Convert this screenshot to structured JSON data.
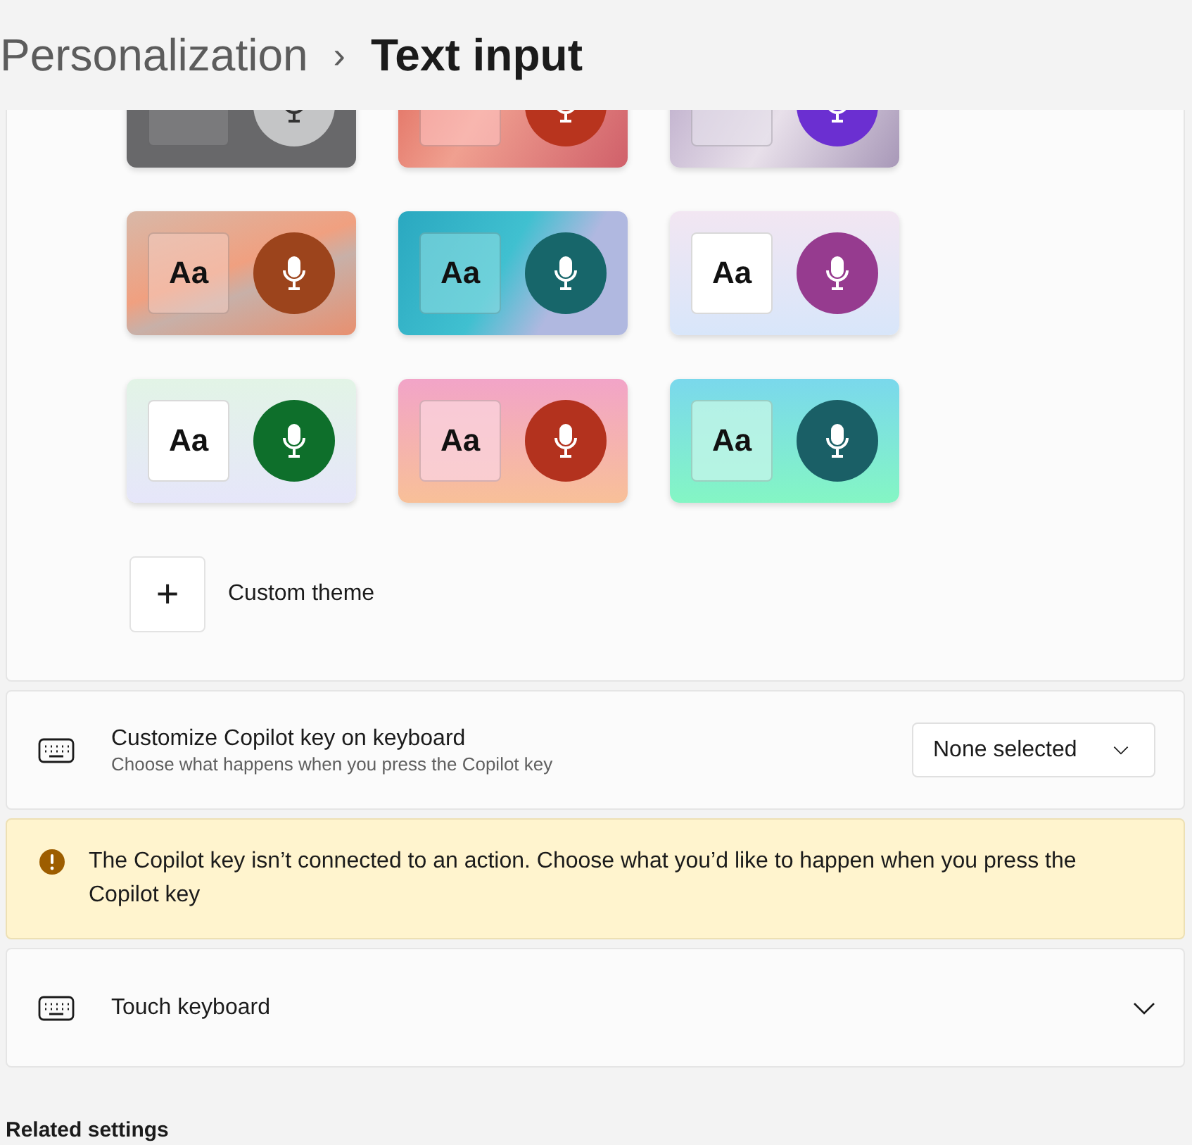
{
  "breadcrumb": {
    "parent": "Personalization",
    "separator": "›",
    "current": "Text input"
  },
  "themes": [
    {
      "color": "#c4c5c6"
    },
    {
      "color": "#b8341e"
    },
    {
      "color": "#6b2fd1"
    },
    {
      "sample": "Aa",
      "color": "#9c441c"
    },
    {
      "sample": "Aa",
      "color": "#17666a"
    },
    {
      "sample": "Aa",
      "color": "#963b8f"
    },
    {
      "sample": "Aa",
      "color": "#0e6f2b"
    },
    {
      "sample": "Aa",
      "color": "#b3321e"
    },
    {
      "sample": "Aa",
      "color": "#1a5f66"
    }
  ],
  "custom_theme": {
    "icon": "+",
    "label": "Custom theme"
  },
  "copilot_key": {
    "title": "Customize Copilot key on keyboard",
    "description": "Choose what happens when you press the Copilot key",
    "dropdown": "None selected"
  },
  "warning": {
    "text": "The Copilot key isn’t connected to an action. Choose what you’d like to happen when you press the Copilot key"
  },
  "touch_keyboard": {
    "title": "Touch keyboard",
    "expanded": false
  },
  "related_settings": "Related settings"
}
